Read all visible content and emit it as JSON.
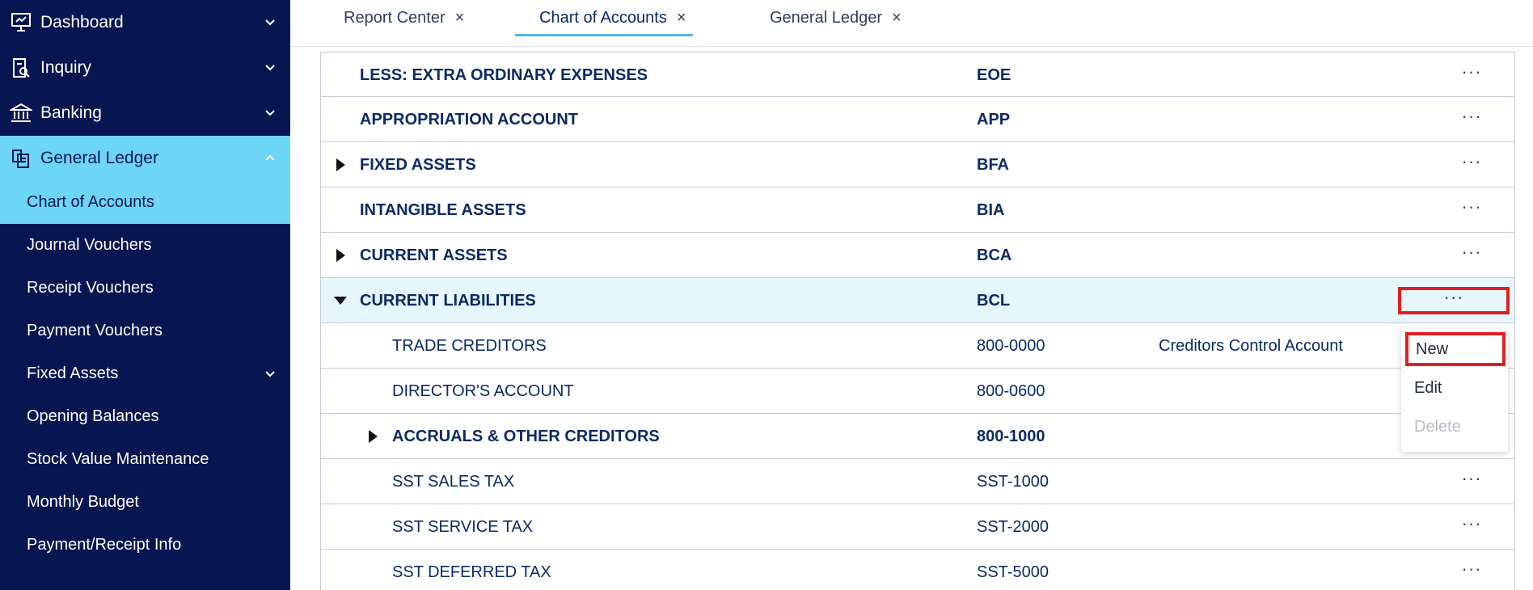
{
  "sidebar": {
    "groups": [
      {
        "label": "Dashboard",
        "icon": "dashboard-icon"
      },
      {
        "label": "Inquiry",
        "icon": "inquiry-icon"
      },
      {
        "label": "Banking",
        "icon": "bank-icon"
      },
      {
        "label": "General Ledger",
        "icon": "ledger-icon"
      }
    ],
    "items": [
      {
        "label": "Chart of Accounts"
      },
      {
        "label": "Journal Vouchers"
      },
      {
        "label": "Receipt Vouchers"
      },
      {
        "label": "Payment Vouchers"
      },
      {
        "label": "Fixed Assets"
      },
      {
        "label": "Opening Balances"
      },
      {
        "label": "Stock Value Maintenance"
      },
      {
        "label": "Monthly Budget"
      },
      {
        "label": "Payment/Receipt Info"
      }
    ]
  },
  "tabs": [
    {
      "label": "Report Center",
      "close": "×"
    },
    {
      "label": "Chart of Accounts",
      "close": "×"
    },
    {
      "label": "General Ledger",
      "close": "×"
    }
  ],
  "table": {
    "rows": [
      {
        "name": "LESS: EXTRA ORDINARY EXPENSES",
        "code": "EOE",
        "desc": "",
        "more": "···"
      },
      {
        "name": "APPROPRIATION ACCOUNT",
        "code": "APP",
        "desc": "",
        "more": "···"
      },
      {
        "name": "FIXED ASSETS",
        "code": "BFA",
        "desc": "",
        "more": "···"
      },
      {
        "name": "INTANGIBLE ASSETS",
        "code": "BIA",
        "desc": "",
        "more": "···"
      },
      {
        "name": "CURRENT ASSETS",
        "code": "BCA",
        "desc": "",
        "more": "···"
      },
      {
        "name": "CURRENT LIABILITIES",
        "code": "BCL",
        "desc": "",
        "more": "···"
      },
      {
        "name": "TRADE CREDITORS",
        "code": "800-0000",
        "desc": "Creditors Control Account",
        "more": ""
      },
      {
        "name": "DIRECTOR'S ACCOUNT",
        "code": "800-0600",
        "desc": "",
        "more": ""
      },
      {
        "name": "ACCRUALS & OTHER CREDITORS",
        "code": "800-1000",
        "desc": "",
        "more": ""
      },
      {
        "name": "SST SALES TAX",
        "code": "SST-1000",
        "desc": "",
        "more": "···"
      },
      {
        "name": "SST SERVICE TAX",
        "code": "SST-2000",
        "desc": "",
        "more": "···"
      },
      {
        "name": "SST DEFERRED TAX",
        "code": "SST-5000",
        "desc": "",
        "more": "···"
      }
    ]
  },
  "context_menu": {
    "new": "New",
    "edit": "Edit",
    "delete": "Delete"
  },
  "colors": {
    "sidebar_bg": "#061650",
    "active_bg": "#6dd5f5",
    "text_primary": "#0b2a66",
    "highlight_border": "#e02020"
  }
}
